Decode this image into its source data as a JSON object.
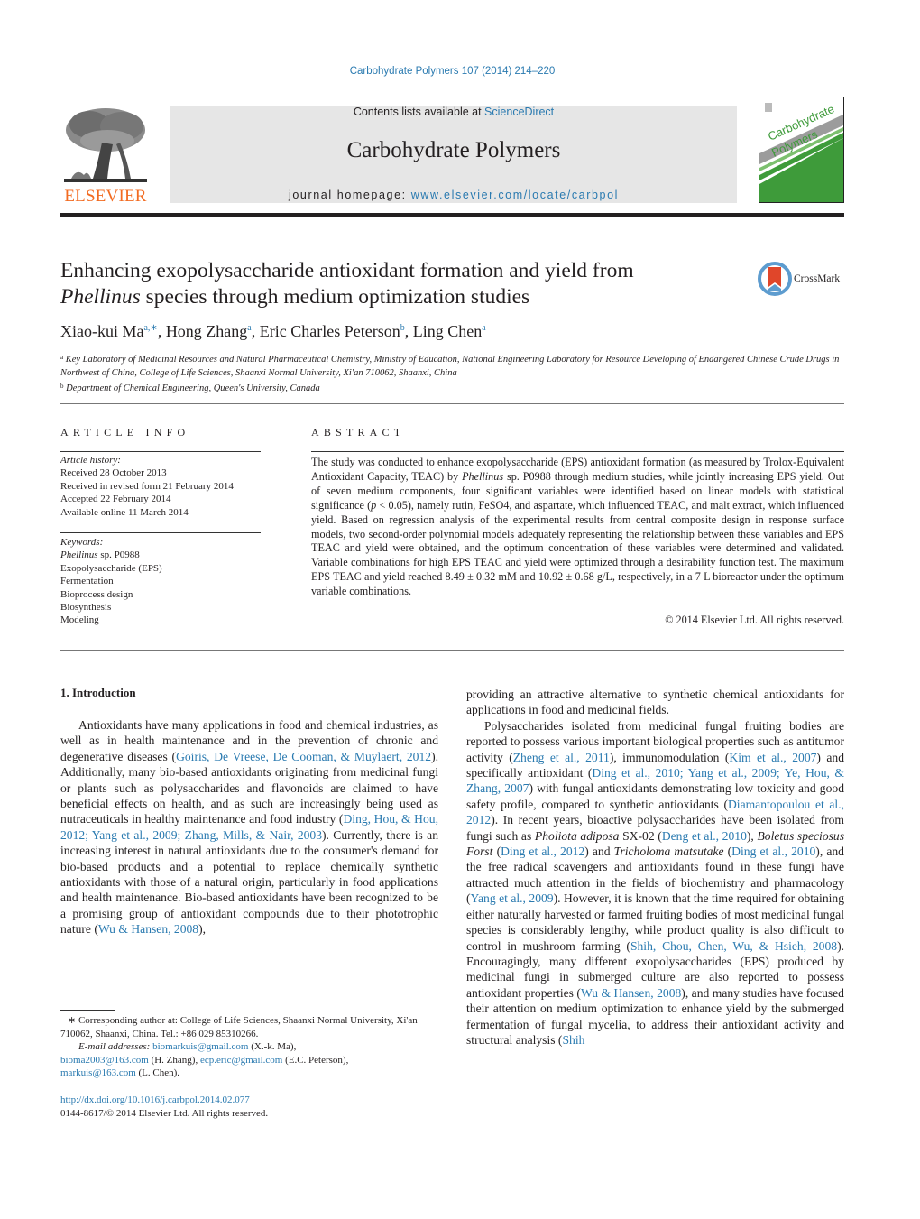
{
  "header": {
    "journal_reference": "Carbohydrate Polymers 107 (2014) 214–220",
    "contents_prefix": "Contents lists available at ",
    "contents_link": "ScienceDirect",
    "journal_name": "Carbohydrate Polymers",
    "homepage_prefix": "journal homepage: ",
    "homepage_url": "www.elsevier.com/locate/carbpol",
    "publisher_logo_text": "ELSEVIER",
    "cover": {
      "title_line1": "Carbohydrate",
      "title_line2": "Polymers",
      "accent_color": "#3e9b3a"
    },
    "brand_color": "#f26b21",
    "link_color": "#2a7ab0"
  },
  "article": {
    "title_line1": "Enhancing exopolysaccharide antioxidant formation and yield from",
    "title_line2_italic": "Phellinus",
    "title_line2_rest": " species through medium optimization studies",
    "crossmark_label": "CrossMark",
    "authors": [
      {
        "name": "Xiao-kui Ma",
        "sup": "a,∗",
        "sep": ", "
      },
      {
        "name": "Hong Zhang",
        "sup": "a",
        "sep": ", "
      },
      {
        "name": "Eric Charles Peterson",
        "sup": "b",
        "sep": ", "
      },
      {
        "name": "Ling Chen",
        "sup": "a",
        "sep": ""
      }
    ],
    "affiliations": [
      {
        "mark": "a",
        "text": "Key Laboratory of Medicinal Resources and Natural Pharmaceutical Chemistry, Ministry of Education, National Engineering Laboratory for Resource Developing of Endangered Chinese Crude Drugs in Northwest of China, College of Life Sciences, Shaanxi Normal University, Xi'an 710062, Shaanxi, China"
      },
      {
        "mark": "b",
        "text": "Department of Chemical Engineering, Queen's University, Canada"
      }
    ]
  },
  "article_info": {
    "heading": "ARTICLE INFO",
    "history_label": "Article history:",
    "history": [
      "Received 28 October 2013",
      "Received in revised form 21 February 2014",
      "Accepted 22 February 2014",
      "Available online 11 March 2014"
    ],
    "keywords_label": "Keywords:",
    "keyword_first_italic": "Phellinus",
    "keyword_first_rest": " sp. P0988",
    "keywords": [
      "Exopolysaccharide (EPS)",
      "Fermentation",
      "Bioprocess design",
      "Biosynthesis",
      "Modeling"
    ]
  },
  "abstract": {
    "heading": "ABSTRACT",
    "part1": "The study was conducted to enhance exopolysaccharide (EPS) antioxidant formation (as measured by Trolox-Equivalent Antioxidant Capacity, TEAC) by ",
    "italic1": "Phellinus",
    "part2": " sp. P0988 through medium studies, while jointly increasing EPS yield. Out of seven medium components, four significant variables were identified based on linear models with statistical significance (",
    "italic2": "p",
    "part3": " < 0.05), namely rutin, FeSO4, and aspartate, which influenced TEAC, and malt extract, which influenced yield. Based on regression analysis of the experimental results from central composite design in response surface models, two second-order polynomial models adequately representing the relationship between these variables and EPS TEAC and yield were obtained, and the optimum concentration of these variables were determined and validated. Variable combinations for high EPS TEAC and yield were optimized through a desirability function test. The maximum EPS TEAC and yield reached 8.49 ± 0.32 mM and 10.92 ± 0.68 g/L, respectively, in a 7 L bioreactor under the optimum variable combinations.",
    "copyright": "© 2014 Elsevier Ltd. All rights reserved."
  },
  "introduction": {
    "heading": "1.  Introduction",
    "left_paragraph": [
      {
        "t": "Antioxidants have many applications in food and chemical industries, as well as in health maintenance and in the prevention of chronic and degenerative diseases ("
      },
      {
        "l": "Goiris, De Vreese, De Cooman, & Muylaert, 2012"
      },
      {
        "t": "). Additionally, many bio-based antioxidants originating from medicinal fungi or plants such as polysaccharides and flavonoids are claimed to have beneficial effects on health, and as such are increasingly being used as nutraceuticals in healthy maintenance and food industry ("
      },
      {
        "l": "Ding, Hou, & Hou, 2012; Yang et al., 2009; Zhang, Mills, & Nair, 2003"
      },
      {
        "t": "). Currently, there is an increasing interest in natural antioxidants due to the consumer's demand for bio-based products and a potential to replace chemically synthetic antioxidants with those of a natural origin, particularly in food applications and health maintenance. Bio-based antioxidants have been recognized to be a promising group of antioxidant compounds due to their phototrophic nature ("
      },
      {
        "l": "Wu & Hansen, 2008"
      },
      {
        "t": "),"
      }
    ],
    "right_continuation": "providing an attractive alternative to synthetic chemical antioxidants for applications in food and medicinal fields.",
    "right_paragraph": [
      {
        "t": "Polysaccharides isolated from medicinal fungal fruiting bodies are reported to possess various important biological properties such as antitumor activity ("
      },
      {
        "l": "Zheng et al., 2011"
      },
      {
        "t": "), immunomodulation ("
      },
      {
        "l": "Kim et al., 2007"
      },
      {
        "t": ") and specifically antioxidant ("
      },
      {
        "l": "Ding et al., 2010; Yang et al., 2009; Ye, Hou, & Zhang, 2007"
      },
      {
        "t": ") with fungal antioxidants demonstrating low toxicity and good safety profile, compared to synthetic antioxidants ("
      },
      {
        "l": "Diamantopoulou et al., 2012"
      },
      {
        "t": "). In recent years, bioactive polysaccharides have been isolated from fungi such as "
      },
      {
        "i": "Pholiota adiposa"
      },
      {
        "t": " SX-02 ("
      },
      {
        "l": "Deng et al., 2010"
      },
      {
        "t": "), "
      },
      {
        "i": "Boletus speciosus Forst"
      },
      {
        "t": " ("
      },
      {
        "l": "Ding et al., 2012"
      },
      {
        "t": ") and "
      },
      {
        "i": "Tricholoma matsutake"
      },
      {
        "t": " ("
      },
      {
        "l": "Ding et al., 2010"
      },
      {
        "t": "), and the free radical scavengers and antioxidants found in these fungi have attracted much attention in the fields of biochemistry and pharmacology ("
      },
      {
        "l": "Yang et al., 2009"
      },
      {
        "t": "). However, it is known that the time required for obtaining either naturally harvested or farmed fruiting bodies of most medicinal fungal species is considerably lengthy, while product quality is also difficult to control in mushroom farming ("
      },
      {
        "l": "Shih, Chou, Chen, Wu, & Hsieh, 2008"
      },
      {
        "t": "). Encouragingly, many different exopolysaccharides (EPS) produced by medicinal fungi in submerged culture are also reported to possess antioxidant properties ("
      },
      {
        "l": "Wu & Hansen, 2008"
      },
      {
        "t": "), and many studies have focused their attention on medium optimization to enhance yield by the submerged fermentation of fungal mycelia, to address their antioxidant activity and structural analysis ("
      },
      {
        "l": "Shih"
      }
    ]
  },
  "footnotes": {
    "corresponding": "∗  Corresponding author at: College of Life Sciences, Shaanxi Normal University, Xi'an 710062, Shaanxi, China. Tel.: +86 029 85310266.",
    "email_label": "E-mail addresses:",
    "emails": [
      {
        "addr": "biomarkuis@gmail.com",
        "who": " (X.-k. Ma),"
      },
      {
        "addr": "bioma2003@163.com",
        "who": " (H. Zhang), "
      },
      {
        "addr": "ecp.eric@gmail.com",
        "who": " (E.C. Peterson),"
      },
      {
        "addr": "markuis@163.com",
        "who": " (L. Chen)."
      }
    ],
    "doi": "http://dx.doi.org/10.1016/j.carbpol.2014.02.077",
    "issn_line": "0144-8617/© 2014 Elsevier Ltd. All rights reserved."
  }
}
